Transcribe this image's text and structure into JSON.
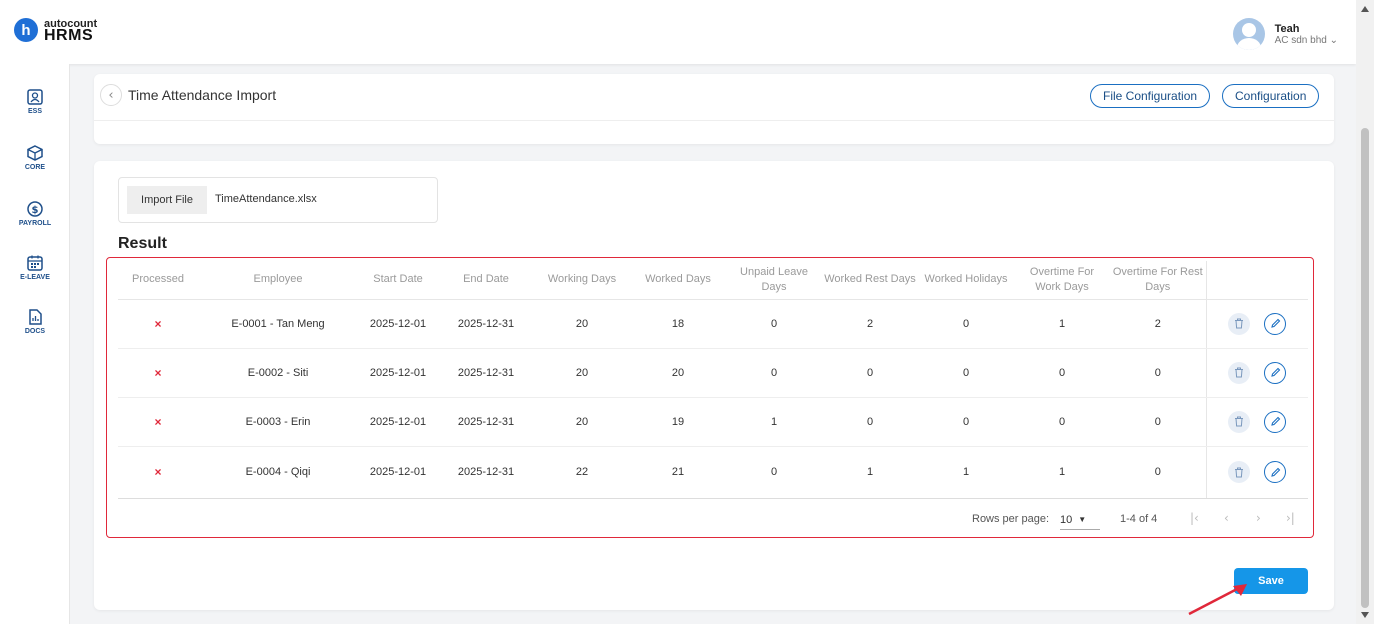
{
  "app": {
    "logo_top": "autocount",
    "logo_bottom": "HRMS"
  },
  "user": {
    "name": "Teah",
    "company": "AC sdn bhd"
  },
  "sidebar": {
    "items": [
      {
        "label": "ESS",
        "icon": "ess-icon"
      },
      {
        "label": "CORE",
        "icon": "core-icon"
      },
      {
        "label": "PAYROLL",
        "icon": "payroll-icon"
      },
      {
        "label": "E-LEAVE",
        "icon": "calendar-icon"
      },
      {
        "label": "DOCS",
        "icon": "docs-icon"
      }
    ]
  },
  "page": {
    "title": "Time Attendance Import",
    "file_config_label": "File Configuration",
    "config_label": "Configuration"
  },
  "import": {
    "label": "Import File",
    "filename": "TimeAttendance.xlsx"
  },
  "result": {
    "title": "Result",
    "columns": [
      "Processed",
      "Employee",
      "Start Date",
      "End Date",
      "Working Days",
      "Worked Days",
      "Unpaid Leave Days",
      "Worked Rest Days",
      "Worked Holidays",
      "Overtime For Work Days",
      "Overtime For Rest Days"
    ],
    "rows": [
      {
        "processed": "×",
        "employee": "E-0001 - Tan Meng",
        "start": "2025-12-01",
        "end": "2025-12-31",
        "working": "20",
        "worked": "18",
        "unpaid": "0",
        "rest": "2",
        "holidays": "0",
        "ot_work": "1",
        "ot_rest": "2"
      },
      {
        "processed": "×",
        "employee": "E-0002 - Siti",
        "start": "2025-12-01",
        "end": "2025-12-31",
        "working": "20",
        "worked": "20",
        "unpaid": "0",
        "rest": "0",
        "holidays": "0",
        "ot_work": "0",
        "ot_rest": "0"
      },
      {
        "processed": "×",
        "employee": "E-0003 - Erin",
        "start": "2025-12-01",
        "end": "2025-12-31",
        "working": "20",
        "worked": "19",
        "unpaid": "1",
        "rest": "0",
        "holidays": "0",
        "ot_work": "0",
        "ot_rest": "0"
      },
      {
        "processed": "×",
        "employee": "E-0004 - Qiqi",
        "start": "2025-12-01",
        "end": "2025-12-31",
        "working": "22",
        "worked": "21",
        "unpaid": "0",
        "rest": "1",
        "holidays": "1",
        "ot_work": "1",
        "ot_rest": "0"
      }
    ]
  },
  "pagination": {
    "rows_per_page_label": "Rows per page:",
    "rows_per_page": "10",
    "range": "1-4 of 4"
  },
  "actions": {
    "save_label": "Save"
  },
  "colors": {
    "accent": "#1596e8",
    "highlight": "#e0283a",
    "processed_fail": "#e0283a"
  }
}
